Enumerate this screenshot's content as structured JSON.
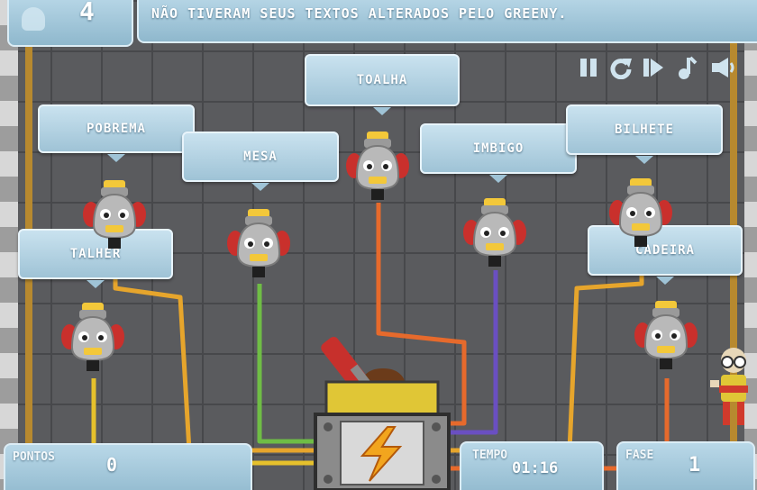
{
  "hud": {
    "level_display": "4",
    "message": "NÃO TIVERAM SEUS TEXTOS ALTERADOS PELO GREENY.",
    "points_label": "PONTOS",
    "points_value": "0",
    "time_label": "TEMPO",
    "time_value": "01:16",
    "stage_label": "FASE",
    "stage_value": "1"
  },
  "controls": [
    {
      "name": "pause-icon"
    },
    {
      "name": "restart-icon"
    },
    {
      "name": "skip-icon"
    },
    {
      "name": "music-icon"
    },
    {
      "name": "sound-icon"
    }
  ],
  "robots": [
    {
      "label": "POBREMA",
      "wire_color": "#e6a52c"
    },
    {
      "label": "MESA",
      "wire_color": "#6fbd45"
    },
    {
      "label": "TOALHA",
      "wire_color": "#e66a2c"
    },
    {
      "label": "IMBIGO",
      "wire_color": "#6a4fc1"
    },
    {
      "label": "BILHETE",
      "wire_color": "#e6a52c"
    },
    {
      "label": "TALHER",
      "wire_color": "#e6c12c"
    },
    {
      "label": "CADEIRA",
      "wire_color": "#e66a2c"
    }
  ],
  "colors": {
    "wall": "#5a5b5e",
    "tag": "#b2d4e5",
    "robot_ear": "#c9302c",
    "robot_hat": "#f3c83a",
    "machine_yellow": "#e0c636"
  }
}
